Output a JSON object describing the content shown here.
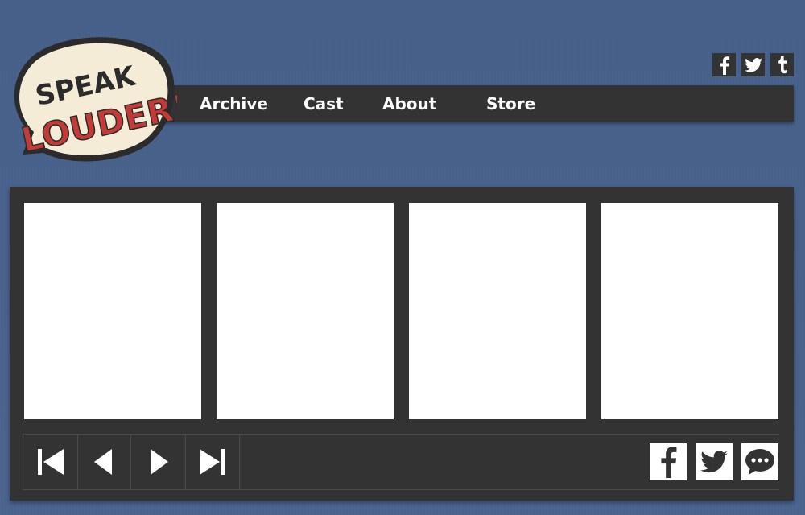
{
  "logo": {
    "line1": "SPEAK",
    "line2": "LOUDER!"
  },
  "colors": {
    "background": "#4a6088",
    "panel": "#333333",
    "logo_bubble": "#f5ecd7",
    "logo_red": "#c43a37"
  },
  "top_social": [
    {
      "name": "facebook-icon",
      "glyph": "f"
    },
    {
      "name": "twitter-icon",
      "glyph": "twitter"
    },
    {
      "name": "tumblr-icon",
      "glyph": "t"
    }
  ],
  "nav": {
    "archive": "Archive",
    "cast": "Cast",
    "about": "About",
    "store": "Store"
  },
  "comic": {
    "frames": 4,
    "controls": [
      "first",
      "previous",
      "next",
      "last"
    ],
    "share": [
      "facebook",
      "twitter",
      "comment"
    ]
  }
}
